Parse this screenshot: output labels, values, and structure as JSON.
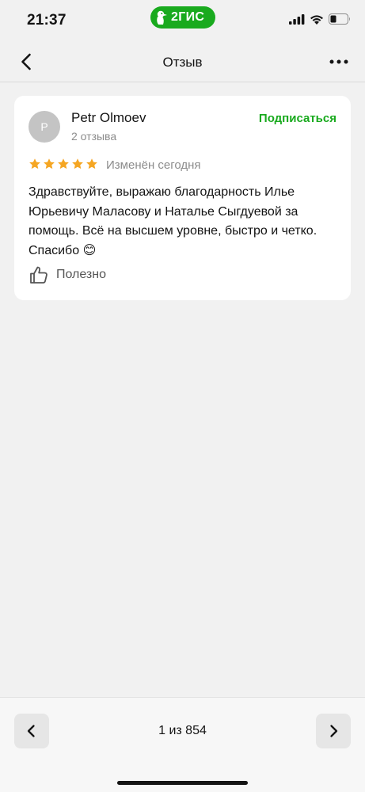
{
  "status_bar": {
    "time": "21:37",
    "brand": "2ГИС",
    "icons": [
      "signal-icon",
      "wifi-icon",
      "battery-icon"
    ]
  },
  "nav": {
    "title": "Отзыв",
    "back_icon": "chevron-left-icon",
    "more_icon": "more-horizontal-icon"
  },
  "review": {
    "avatar_letter": "P",
    "author": "Petr Olmoev",
    "reviews_count": "2 отзыва",
    "subscribe_label": "Подписаться",
    "rating": 5,
    "edited": "Изменён сегодня",
    "text": "Здравствуйте, выражаю благодарность Илье Юрьевичу Маласову и Наталье Сыгдуевой за помощь. Всё на высшем уровне, быстро и четко. Спасибо 😊",
    "useful_label": "Полезно"
  },
  "pager": {
    "label": "1 из 854"
  },
  "colors": {
    "accent": "#19aa1e",
    "star": "#f5a623",
    "background": "#f1f1f1",
    "card": "#ffffff"
  }
}
